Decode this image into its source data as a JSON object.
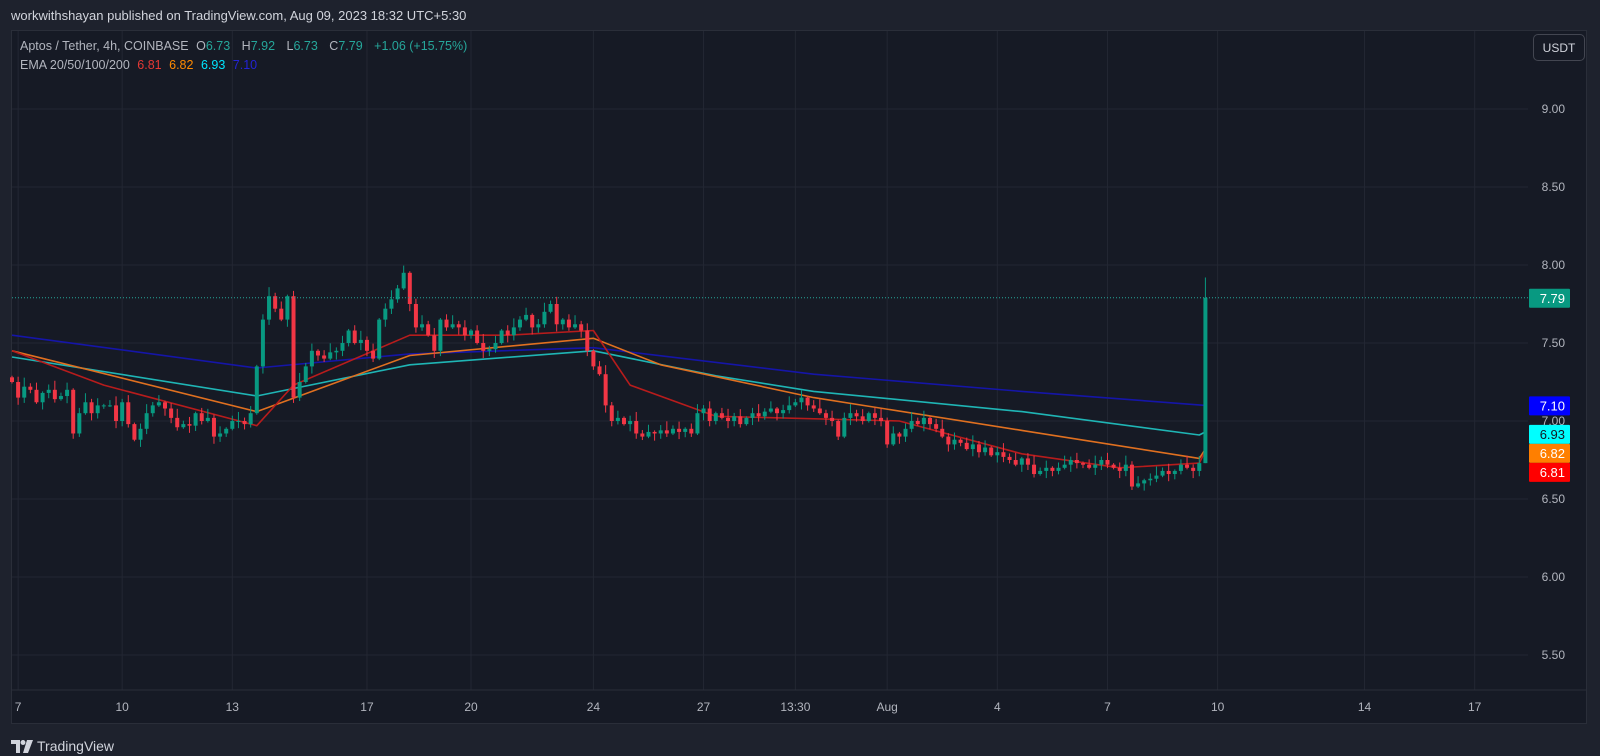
{
  "publisher_line": "workwithshayan published on TradingView.com, Aug 09, 2023 18:32 UTC+5:30",
  "legend": {
    "symbol": "Aptos / Tether, 4h, COINBASE",
    "o_label": "O",
    "o": "6.73",
    "h_label": "H",
    "h": "7.92",
    "l_label": "L",
    "l": "6.73",
    "c_label": "C",
    "c": "7.79",
    "change": "+1.06 (+15.75%)",
    "ema_label": "EMA 20/50/100/200",
    "ema20": "6.81",
    "ema50": "6.82",
    "ema100": "6.93",
    "ema200": "7.10"
  },
  "currency_button": "USDT",
  "brand": "TradingView",
  "colors": {
    "up": "#089981",
    "down": "#f23645",
    "ema20": "#b71c1c",
    "ema50": "#e07020",
    "ema100": "#1fb5b5",
    "ema200": "#1515a8",
    "bg": "#161a25",
    "grid": "#232733"
  },
  "chart_data": {
    "type": "candlestick",
    "title": "Aptos / Tether, 4h, COINBASE",
    "ylim": [
      5.3,
      9.3
    ],
    "y_ticks": [
      "5.50",
      "6.00",
      "6.50",
      "7.00",
      "7.50",
      "8.00",
      "8.50",
      "9.00"
    ],
    "x_ticks": [
      {
        "label": "7",
        "index": 1
      },
      {
        "label": "10",
        "index": 18
      },
      {
        "label": "13",
        "index": 36
      },
      {
        "label": "17",
        "index": 58
      },
      {
        "label": "20",
        "index": 75
      },
      {
        "label": "24",
        "index": 95
      },
      {
        "label": "27",
        "index": 113
      },
      {
        "label": "13:30",
        "index": 128
      },
      {
        "label": "Aug",
        "index": 143
      },
      {
        "label": "4",
        "index": 161
      },
      {
        "label": "7",
        "index": 179
      },
      {
        "label": "10",
        "index": 197
      },
      {
        "label": "14",
        "index": 221
      },
      {
        "label": "17",
        "index": 239
      }
    ],
    "closes": [
      7.25,
      7.15,
      7.22,
      7.2,
      7.12,
      7.18,
      7.2,
      7.14,
      7.16,
      7.2,
      6.92,
      7.05,
      7.12,
      7.05,
      7.1,
      7.1,
      7.1,
      7.0,
      7.12,
      6.98,
      6.88,
      6.95,
      7.05,
      7.1,
      7.12,
      7.08,
      7.02,
      6.96,
      6.98,
      6.97,
      7.05,
      7.0,
      7.02,
      6.9,
      6.92,
      6.95,
      7.0,
      7.0,
      6.98,
      7.05,
      7.35,
      7.65,
      7.8,
      7.72,
      7.65,
      7.8,
      7.15,
      7.25,
      7.35,
      7.45,
      7.42,
      7.4,
      7.44,
      7.45,
      7.5,
      7.58,
      7.5,
      7.52,
      7.45,
      7.4,
      7.65,
      7.72,
      7.78,
      7.85,
      7.95,
      7.75,
      7.6,
      7.62,
      7.55,
      7.45,
      7.65,
      7.6,
      7.62,
      7.6,
      7.55,
      7.58,
      7.5,
      7.45,
      7.46,
      7.5,
      7.58,
      7.55,
      7.6,
      7.65,
      7.68,
      7.6,
      7.62,
      7.7,
      7.75,
      7.62,
      7.65,
      7.6,
      7.62,
      7.58,
      7.45,
      7.35,
      7.3,
      7.1,
      7.0,
      7.02,
      6.98,
      7.0,
      6.92,
      6.9,
      6.93,
      6.92,
      6.94,
      6.92,
      6.95,
      6.93,
      6.95,
      6.92,
      7.05,
      7.08,
      7.0,
      7.05,
      7.02,
      7.0,
      7.03,
      6.98,
      7.02,
      7.05,
      7.03,
      7.06,
      7.08,
      7.05,
      7.07,
      7.1,
      7.12,
      7.15,
      7.1,
      7.08,
      7.05,
      7.02,
      7.0,
      6.9,
      7.02,
      7.05,
      7.03,
      7.0,
      7.05,
      7.02,
      7.0,
      6.85,
      6.92,
      6.9,
      6.95,
      7.0,
      6.98,
      7.02,
      6.98,
      6.95,
      6.9,
      6.85,
      6.88,
      6.86,
      6.82,
      6.85,
      6.8,
      6.83,
      6.78,
      6.8,
      6.77,
      6.75,
      6.72,
      6.76,
      6.72,
      6.66,
      6.68,
      6.7,
      6.68,
      6.7,
      6.72,
      6.75,
      6.73,
      6.72,
      6.7,
      6.72,
      6.75,
      6.72,
      6.7,
      6.68,
      6.72,
      6.58,
      6.6,
      6.62,
      6.63,
      6.65,
      6.68,
      6.66,
      6.68,
      6.72,
      6.7,
      6.68,
      6.73
    ],
    "last_candle": {
      "open": 6.73,
      "high": 7.92,
      "low": 6.73,
      "close": 7.79
    },
    "ema": {
      "ema20": [
        [
          0,
          7.45
        ],
        [
          15,
          7.23
        ],
        [
          40,
          6.97
        ],
        [
          46,
          7.23
        ],
        [
          65,
          7.55
        ],
        [
          81,
          7.55
        ],
        [
          95,
          7.58
        ],
        [
          101,
          7.23
        ],
        [
          115,
          7.03
        ],
        [
          145,
          7.0
        ],
        [
          165,
          6.79
        ],
        [
          181,
          6.7
        ],
        [
          194,
          6.73
        ],
        [
          195,
          6.81
        ]
      ],
      "ema50": [
        [
          0,
          7.45
        ],
        [
          40,
          7.06
        ],
        [
          65,
          7.42
        ],
        [
          95,
          7.53
        ],
        [
          106,
          7.36
        ],
        [
          131,
          7.15
        ],
        [
          165,
          6.94
        ],
        [
          194,
          6.76
        ],
        [
          195,
          6.82
        ]
      ],
      "ema100": [
        [
          0,
          7.41
        ],
        [
          40,
          7.16
        ],
        [
          65,
          7.36
        ],
        [
          95,
          7.45
        ],
        [
          115,
          7.29
        ],
        [
          131,
          7.19
        ],
        [
          165,
          7.06
        ],
        [
          194,
          6.91
        ],
        [
          195,
          6.93
        ]
      ],
      "ema200": [
        [
          0,
          7.55
        ],
        [
          40,
          7.34
        ],
        [
          65,
          7.43
        ],
        [
          95,
          7.47
        ],
        [
          131,
          7.3
        ],
        [
          165,
          7.19
        ],
        [
          195,
          7.1
        ]
      ]
    },
    "price_labels": [
      {
        "value": "7.79",
        "bg": "#089981",
        "fg": "#ffffff"
      },
      {
        "value": "7.10",
        "bg": "#0000ff",
        "fg": "#ffffff"
      },
      {
        "value": "6.93",
        "bg": "#00ffff",
        "fg": "#131722"
      },
      {
        "value": "6.82",
        "bg": "#ff7f00",
        "fg": "#ffffff"
      },
      {
        "value": "6.81",
        "bg": "#ff0000",
        "fg": "#ffffff"
      }
    ]
  }
}
